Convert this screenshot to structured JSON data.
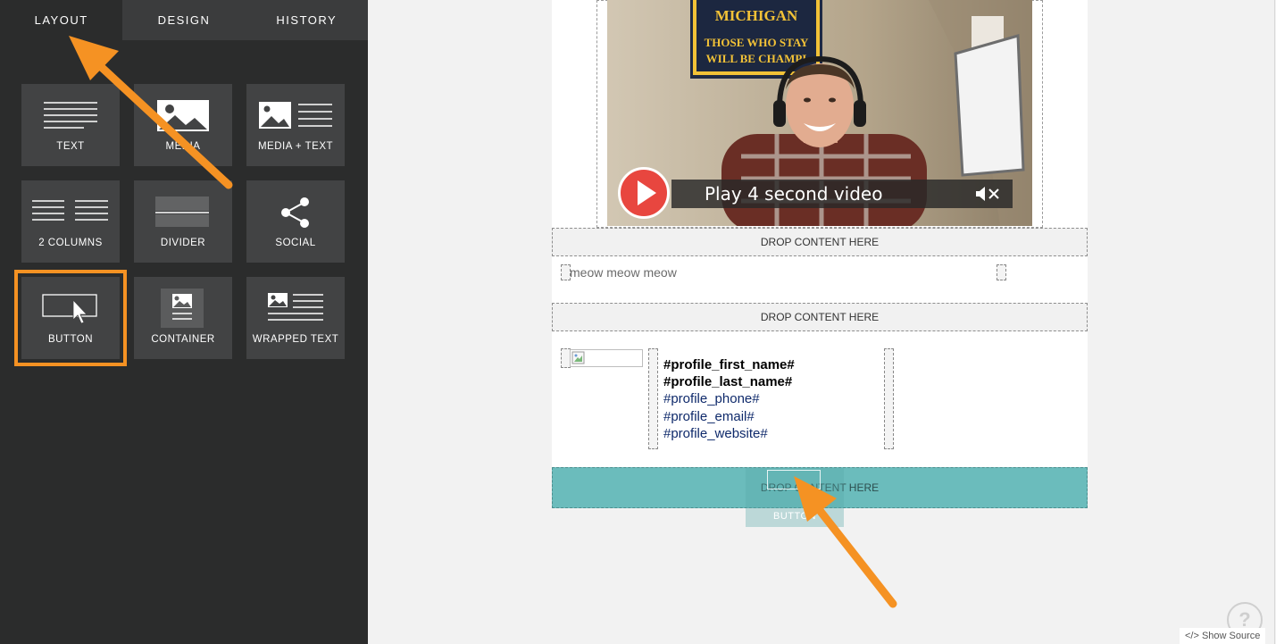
{
  "tabs": [
    {
      "label": "LAYOUT",
      "active": true
    },
    {
      "label": "DESIGN",
      "active": false
    },
    {
      "label": "HISTORY",
      "active": false
    }
  ],
  "blocks": [
    {
      "label": "TEXT",
      "icon": "text-lines-icon"
    },
    {
      "label": "MEDIA",
      "icon": "image-icon"
    },
    {
      "label": "MEDIA + TEXT",
      "icon": "image-with-text-icon"
    },
    {
      "label": "2 COLUMNS",
      "icon": "two-columns-icon"
    },
    {
      "label": "DIVIDER",
      "icon": "divider-icon"
    },
    {
      "label": "SOCIAL",
      "icon": "share-icon"
    },
    {
      "label": "BUTTON",
      "icon": "button-cursor-icon",
      "selected": true
    },
    {
      "label": "CONTAINER",
      "icon": "container-icon"
    },
    {
      "label": "WRAPPED TEXT",
      "icon": "wrapped-text-icon"
    }
  ],
  "canvas": {
    "video": {
      "play_label": "Play 4 second video",
      "banner_line1": "MICHIGAN",
      "banner_line2": "THOSE WHO STAY",
      "banner_line3": "WILL BE CHAMPI"
    },
    "drop_zone_label": "DROP CONTENT HERE",
    "text_block": "meow meow meow",
    "profile": {
      "first_name": "#profile_first_name#",
      "last_name": "#profile_last_name#",
      "phone": "#profile_phone#",
      "email": "#profile_email#",
      "website": "#profile_website#"
    },
    "drag_ghost_label": "BUTTON"
  },
  "footer": {
    "help_label": "?",
    "show_source_label": "</> Show Source"
  },
  "colors": {
    "sidebar_bg": "#2b2c2c",
    "tile_bg": "#424344",
    "highlight_orange": "#f59223",
    "drop_highlight": "#6bbcbc",
    "play_red": "#e8463f"
  }
}
